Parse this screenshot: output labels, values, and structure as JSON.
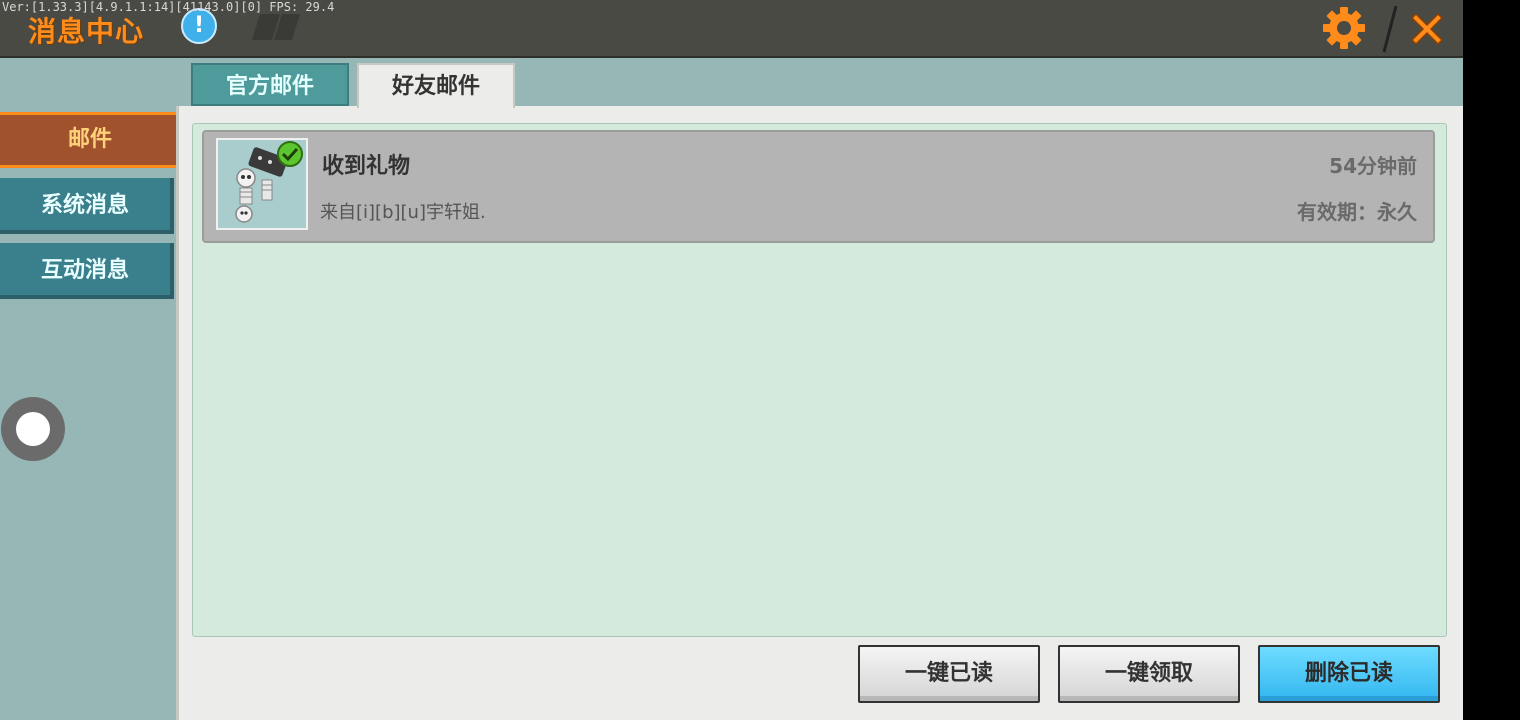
{
  "debug_text": "Ver:[1.33.3][4.9.1.1:14][41143.0][0] FPS: 29.4",
  "header": {
    "title": "消息中心",
    "info_symbol": "!"
  },
  "sidebar": {
    "items": [
      {
        "label": "邮件",
        "active": true
      },
      {
        "label": "系统消息",
        "active": false
      },
      {
        "label": "互动消息",
        "active": false
      }
    ]
  },
  "tabs": [
    {
      "label": "官方邮件",
      "active": false
    },
    {
      "label": "好友邮件",
      "active": true
    }
  ],
  "mails": [
    {
      "title": "收到礼物",
      "from": "来自[i][b][u]宇轩姐.",
      "time": "54分钟前",
      "expire": "有效期：永久",
      "claimed": true,
      "icon": "skeleton-item-icon"
    }
  ],
  "actions": {
    "read_all": "一键已读",
    "claim_all": "一键领取",
    "delete_read": "删除已读"
  },
  "colors": {
    "accent": "#ff8c1a",
    "primary_button": "#32b6f0",
    "list_background": "#d4eadc"
  }
}
